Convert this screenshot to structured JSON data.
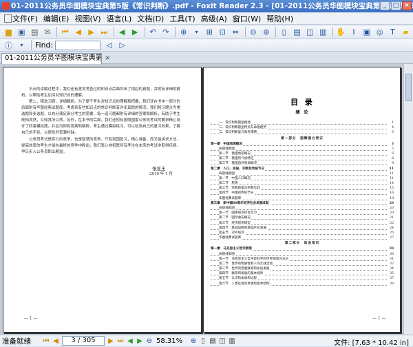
{
  "window": {
    "title": "01-2011公务员华图模块宝典第5版《常识判断》.pdf - Foxit Reader 2.3 - [01-2011公务员华图模块宝典第5版《常识判断》.pdf]",
    "min": "_",
    "max": "□",
    "close": "×"
  },
  "menu": [
    "文件(F)",
    "编辑(E)",
    "视图(V)",
    "语言(L)",
    "文档(D)",
    "工具(T)",
    "高级(A)",
    "窗口(W)",
    "帮助(H)"
  ],
  "toolbar": {
    "find_label": "Find:",
    "find_value": ""
  },
  "tab": {
    "label": "01-2011公务员华图模块宝典第...",
    "close": "×"
  },
  "left_page": {
    "paragraphs": [
      "识点的讲解过程中，我们还有意将考查过的知识点后面列出了相应的真题，并附有详细的解析，以帮助考生加深对知识点的理解。",
      "第二，精选习题，详细解析。为了便于考生对知识点的理解和把握，我们还在书中一部分的后面附有华图经典试题库。考虑到有些知识点的常识判断有许多真题的情况，我们将习题分为常选题和多选题，以充分满足部分考生的需要。每一道习题都附有详细的答案和解析，有助于考生既知其然，又知其所以然。另外，在本书的后面，我们还附有按照国家公务员考试的要求精心设计了四套模拟题，并且均附有答案和解析。考生通过模拟练习，可以检测自己的复习效果，了解自己的不足，以便及时查漏补缺。",
      "公务员考试是实力的竞争，也是智慧的竞争，只有到国复习，精心准备，而又能讲求方法，提高效率的考生才能在最终的竞争中胜出。我们衷心地祝愿所有考生在未来的考试中取得佳绩，早日步入公务员职业殿堂。"
    ],
    "signature_name": "张显玉",
    "signature_date": "2010 年 1 月",
    "page_number": "— 1 —"
  },
  "right_page": {
    "title": "目  录",
    "intro_heading": "绪  论",
    "intro_items": [
      {
        "text": "一、常识判断题型概述",
        "page": "1"
      },
      {
        "text": "二、常识判断题型特点与命题趋势",
        "page": "4"
      },
      {
        "text": "三、常识判断复习备考策略",
        "page": "5"
      }
    ],
    "part1": "第一部分　国情国力常识",
    "rows": [
      {
        "kind": "chapter",
        "text": "第一章　中国地理概况",
        "page": "5"
      },
      {
        "kind": "section",
        "text": "命题线索图",
        "page": "5"
      },
      {
        "kind": "section",
        "text": "第一节　我国地形概况",
        "page": "6"
      },
      {
        "kind": "section",
        "text": "第二节　我国的气候特征",
        "page": "8"
      },
      {
        "kind": "section",
        "text": "第三节　我国自然资源概况",
        "page": "9"
      },
      {
        "kind": "chapter",
        "text": "第二章　人口、民族、宗教及传统节日",
        "page": "11"
      },
      {
        "kind": "section",
        "text": "命题线索图",
        "page": "11"
      },
      {
        "kind": "section",
        "text": "第一节　中国人口概况",
        "page": "11"
      },
      {
        "kind": "section",
        "text": "第二节　民族",
        "page": "14"
      },
      {
        "kind": "section",
        "text": "第三节　宗教政策与宗教信仰",
        "page": "15"
      },
      {
        "kind": "section",
        "text": "第四节　中国的传统节日",
        "page": "16"
      },
      {
        "kind": "section",
        "text": "华图经典试题库",
        "page": "18"
      },
      {
        "kind": "chapter",
        "text": "第三章　新中国60周年经济社会发展成就",
        "page": "20"
      },
      {
        "kind": "section",
        "text": "命题线索图",
        "page": "20"
      },
      {
        "kind": "section",
        "text": "第一节　国民经济综合实力",
        "page": "20"
      },
      {
        "kind": "section",
        "text": "第二节　国际收支概况",
        "page": "21"
      },
      {
        "kind": "section",
        "text": "第三节　经济结构转型",
        "page": "22"
      },
      {
        "kind": "section",
        "text": "第四节　基础设施和基础产业发展",
        "page": "24"
      },
      {
        "kind": "section",
        "text": "第五节　对外经济",
        "page": "25"
      },
      {
        "kind": "section",
        "text": "华图经典试题库",
        "page": "27"
      }
    ],
    "part2": "第二部分　政治常识",
    "rows2": [
      {
        "kind": "chapter",
        "text": "第一章　马克思主义哲学原理",
        "page": "30"
      },
      {
        "kind": "section",
        "text": "命题线索图",
        "page": "30"
      },
      {
        "kind": "section",
        "text": "第一节　马克思主义哲学是科学的世界观和方法论",
        "page": "31"
      },
      {
        "kind": "section",
        "text": "第二节　世界的物质性和人的实践活动",
        "page": "32"
      },
      {
        "kind": "section",
        "text": "第三节　世界的普遍联系和永恒发展",
        "page": "34"
      },
      {
        "kind": "section",
        "text": "第四节　联系和发展的基本规律",
        "page": "35"
      },
      {
        "kind": "section",
        "text": "第五节　认识的本质和过程",
        "page": "37"
      },
      {
        "kind": "section",
        "text": "第六节　人类社会的本质和基本结构",
        "page": "38"
      }
    ],
    "page_number": "— 1 —"
  },
  "status": {
    "ready": "准备就绪",
    "page_box": "3 / 305",
    "zoom": "58.31%",
    "doc_size": "文件: [7.63 * 10.42 in]"
  }
}
